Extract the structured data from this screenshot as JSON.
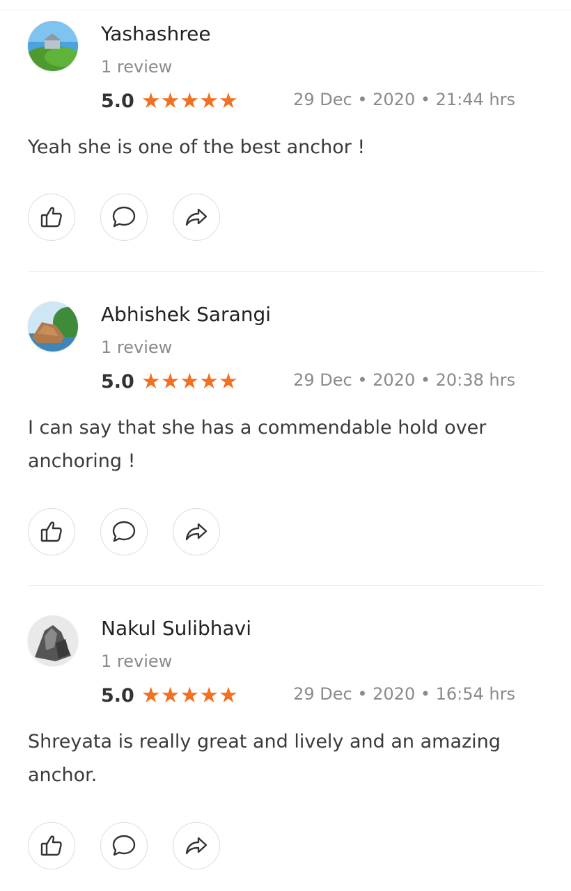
{
  "theme": {
    "star_color": "#f36f21",
    "divider_color": "#e6e6e6",
    "muted_text": "#8a8a8a"
  },
  "reviews": [
    {
      "avatar_icon": "landscape-hill-photo",
      "name": "Yashashree",
      "review_count": "1 review",
      "rating": "5.0",
      "stars": "★★★★★",
      "date": "29 Dec • 2020 • 21:44 hrs",
      "text": "Yeah she is one of the best anchor !",
      "actions": [
        "like-icon",
        "comment-icon",
        "share-icon"
      ]
    },
    {
      "avatar_icon": "coastal-rock-photo",
      "name": "Abhishek Sarangi",
      "review_count": "1 review",
      "rating": "5.0",
      "stars": "★★★★★",
      "date": "29 Dec • 2020 • 20:38 hrs",
      "text": "I can say that she has a commendable hold over anchoring !",
      "actions": [
        "like-icon",
        "comment-icon",
        "share-icon"
      ]
    },
    {
      "avatar_icon": "rock-photo",
      "name": "Nakul Sulibhavi",
      "review_count": "1 review",
      "rating": "5.0",
      "stars": "★★★★★",
      "date": "29 Dec • 2020 • 16:54 hrs",
      "text": "Shreyata is really great and lively and an amazing anchor.",
      "actions": [
        "like-icon",
        "comment-icon",
        "share-icon"
      ]
    }
  ]
}
